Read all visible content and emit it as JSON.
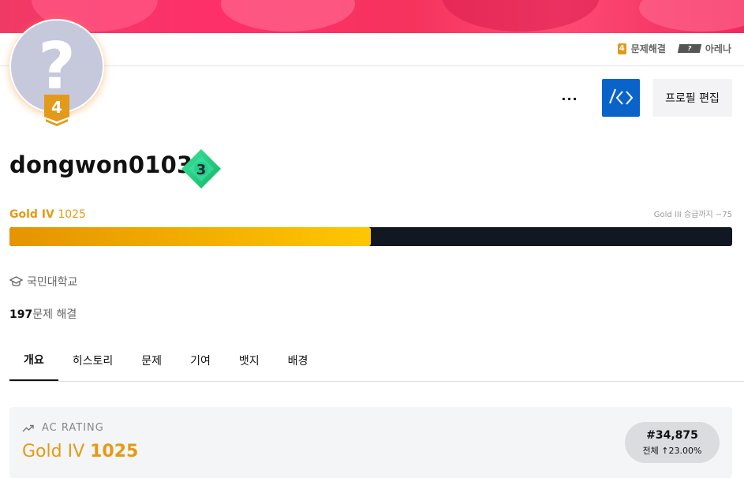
{
  "header": {
    "tier_link": {
      "badge": "4",
      "label": "문제해결"
    },
    "arena_link": {
      "badge": "?",
      "label": "아레나"
    }
  },
  "profile": {
    "avatar_glyph": "?",
    "tier_badge_number": "4",
    "username": "dongwon0103",
    "class_badge_number": "3",
    "more_label": "···",
    "edit_label": "프로필 편집"
  },
  "rating": {
    "tier_name": "Gold IV",
    "value": "1025",
    "next_tier_text": "Gold III 승급까지 −75",
    "progress_fraction": 0.5
  },
  "info": {
    "school": "국민대학교",
    "solved_count": "197",
    "solved_suffix": "문제 해결"
  },
  "tabs": [
    {
      "label": "개요",
      "active": true
    },
    {
      "label": "히스토리",
      "active": false
    },
    {
      "label": "문제",
      "active": false
    },
    {
      "label": "기여",
      "active": false
    },
    {
      "label": "뱃지",
      "active": false
    },
    {
      "label": "배경",
      "active": false
    }
  ],
  "ac_card": {
    "title": "AC RATING",
    "tier_name": "Gold IV",
    "value": "1025",
    "rank": "#34,875",
    "rank_sub": "전체 ↑23.00%"
  },
  "colors": {
    "gold": "#e59a14",
    "banner": "#f5335d",
    "code_button": "#0a63c9",
    "class_badge": "#1fd07a"
  },
  "icons": {
    "more": "more-dots-icon",
    "code": "code-icon",
    "school": "graduation-cap-icon",
    "trend": "trending-up-icon"
  }
}
